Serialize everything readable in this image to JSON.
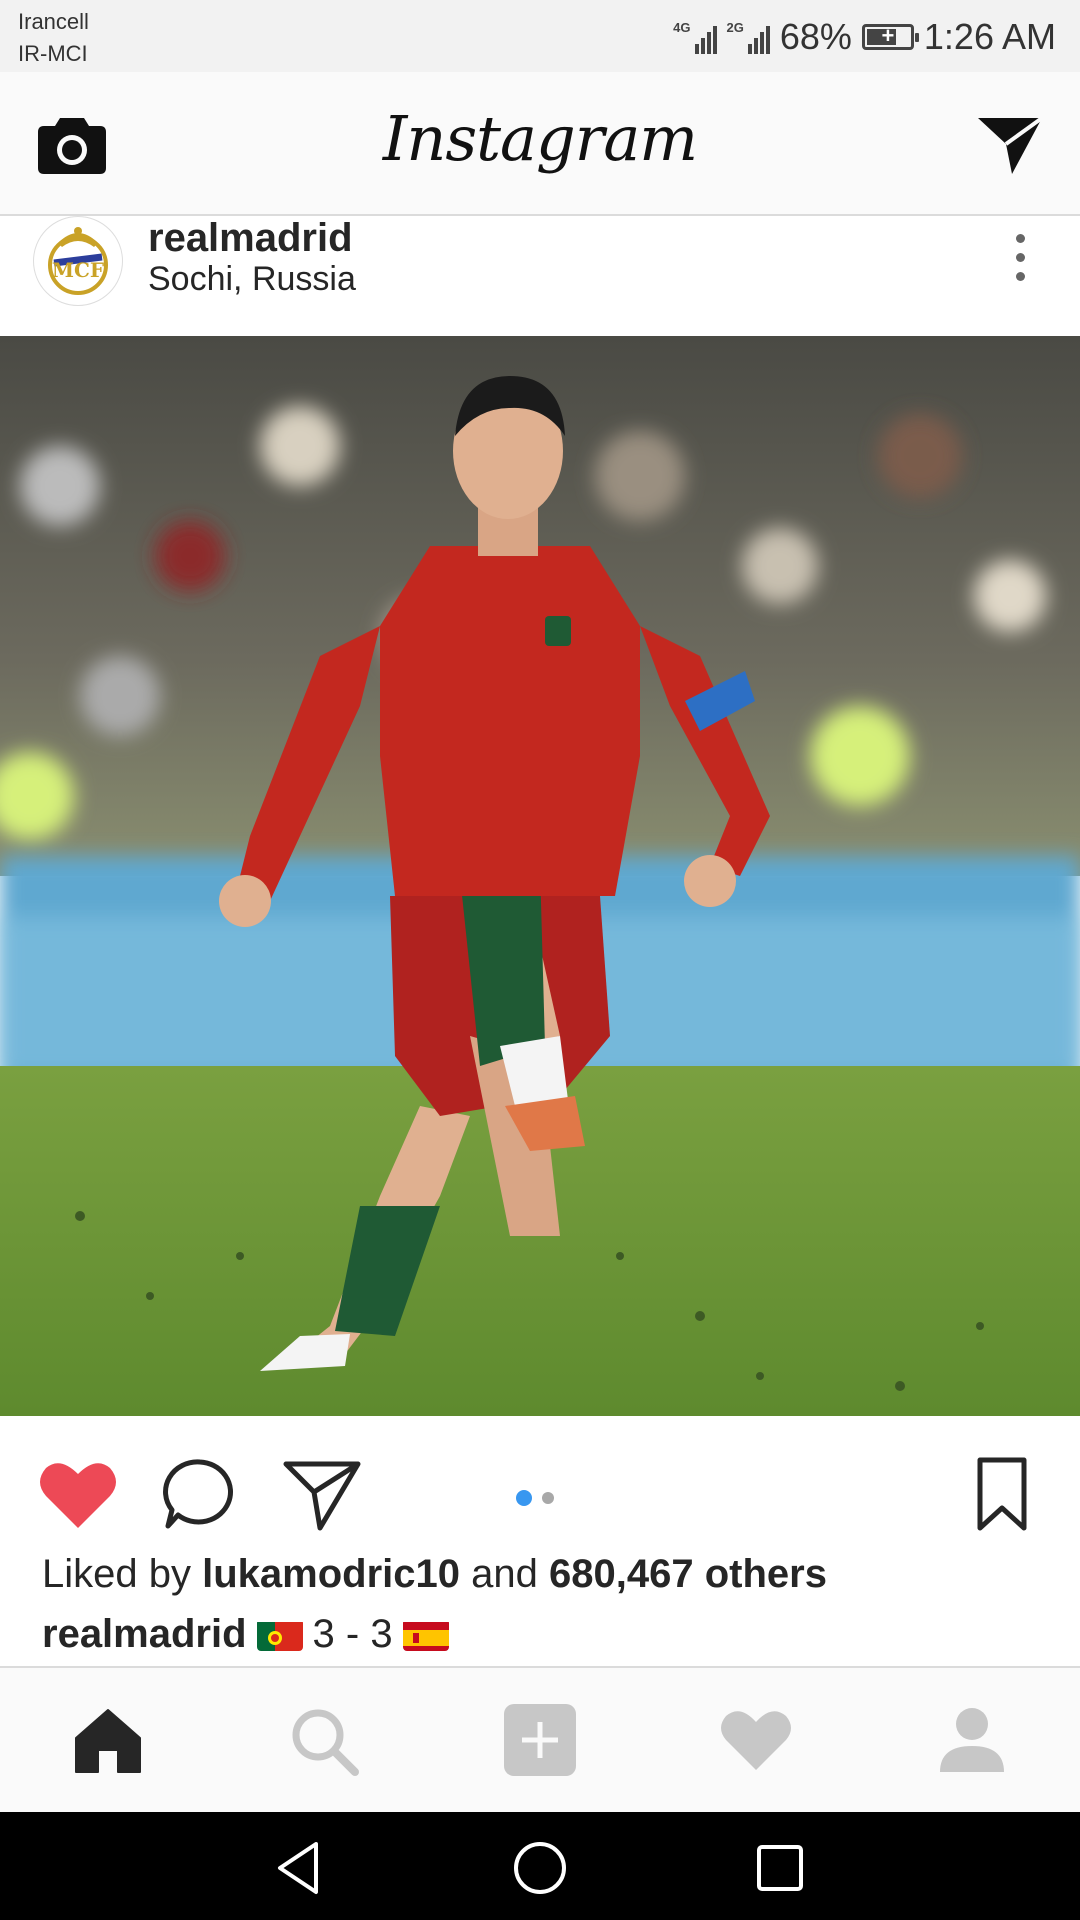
{
  "status_bar": {
    "carrier_line1": "Irancell",
    "carrier_line2": "IR-MCI",
    "network1": "4G",
    "network2": "2G",
    "battery_percent": "68%",
    "battery_level": 0.68,
    "time": "1:26 AM"
  },
  "header": {
    "brand": "Instagram",
    "left_icon": "camera-icon",
    "right_icon": "direct-message-icon"
  },
  "post": {
    "username": "realmadrid",
    "location": "Sochi, Russia",
    "menu_icon": "more-vertical-icon",
    "image_description_icon": "photo",
    "carousel": {
      "count": 2,
      "active_index": 0
    },
    "likes": {
      "prefix": "Liked by",
      "user": "lukamodric10",
      "middle": "and",
      "count": "680,467 others"
    },
    "caption": {
      "user": "realmadrid",
      "score": "3 - 3",
      "flag_left": "portugal-flag",
      "flag_right": "spain-flag"
    },
    "liked": true
  },
  "bottom_nav": {
    "items": [
      "home-icon",
      "search-icon",
      "add-post-icon",
      "activity-heart-icon",
      "profile-icon"
    ],
    "active": "home-icon"
  },
  "android_nav": [
    "back-icon",
    "home-circle-icon",
    "recents-icon"
  ],
  "colors": {
    "like_red": "#ed4956",
    "active_dot": "#3897f0",
    "inactive_dot": "#a8a8a8",
    "icon_dark": "#262626",
    "icon_inactive": "#c7c7c7"
  }
}
